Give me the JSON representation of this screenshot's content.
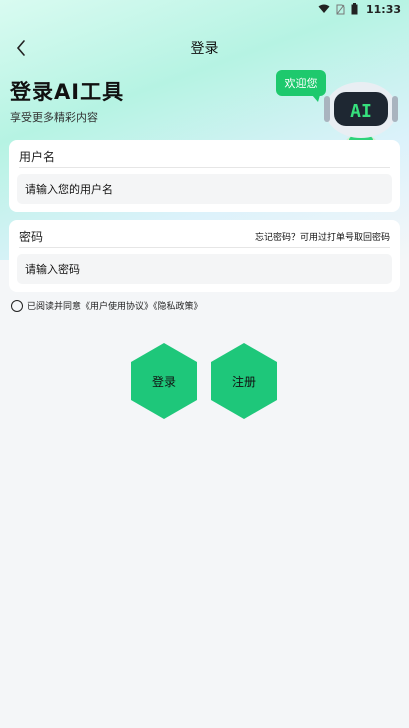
{
  "status_bar": {
    "time": "11:33"
  },
  "nav": {
    "title": "登录",
    "back_icon": "chevron-left-icon"
  },
  "hero": {
    "headline": "登录AI工具",
    "subheadline": "享受更多精彩内容",
    "bubble_text": "欢迎您",
    "robot_screen_text": "AI"
  },
  "form": {
    "username_label": "用户名",
    "username_placeholder": "请输入您的用户名",
    "password_label": "密码",
    "password_placeholder": "请输入密码",
    "forgot_text": "忘记密码？可用过打单号取回密码"
  },
  "agreement": {
    "text": "已阅读并同意《用户使用协议》《隐私政策》"
  },
  "buttons": {
    "login": "登录",
    "register": "注册"
  },
  "colors": {
    "accent": "#1ec77a",
    "bubble": "#1ec96d"
  }
}
